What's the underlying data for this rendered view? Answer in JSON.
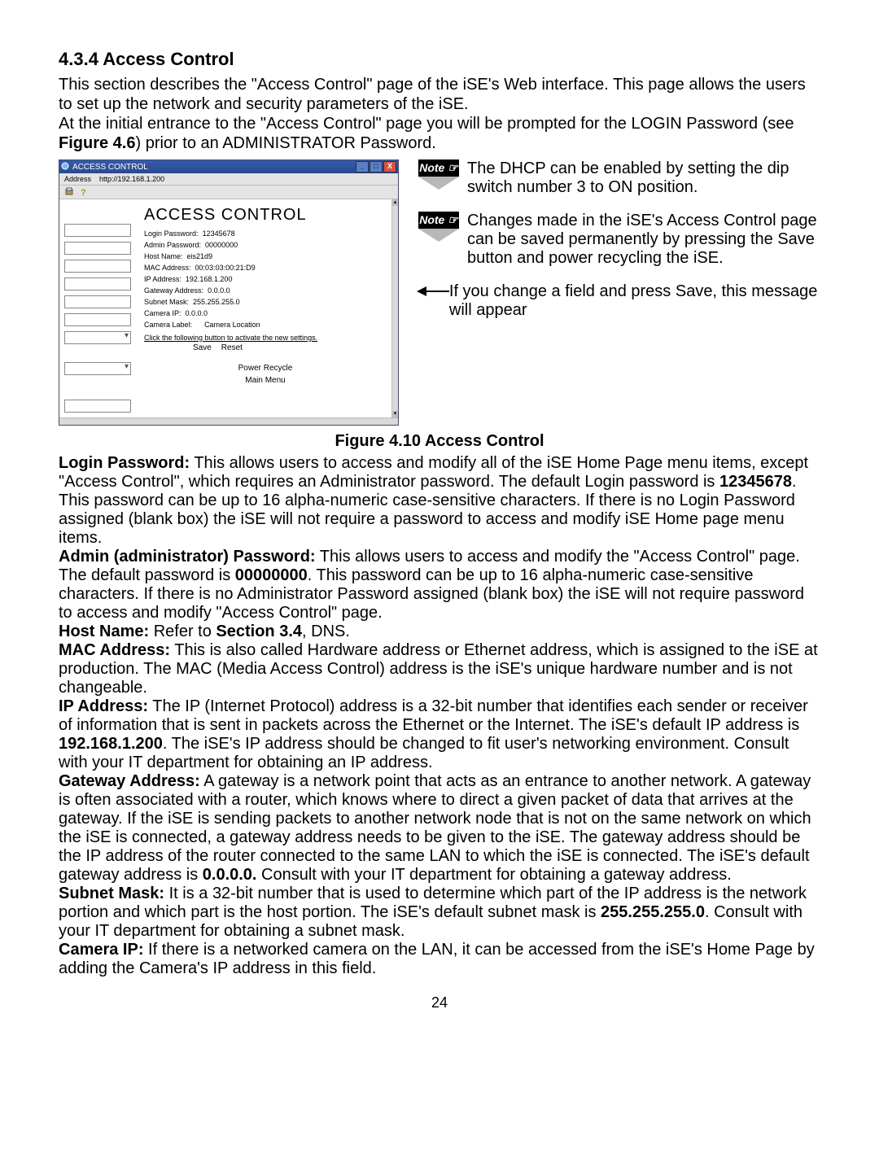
{
  "heading": "4.3.4  Access Control",
  "intro": {
    "l1": "This section describes the \"Access Control\" page of the iSE's Web interface.  This page allows the users to set up the network and security parameters of the iSE.",
    "l2a": "At the initial entrance to the \"Access Control\" page you will be prompted for the LOGIN Password (see ",
    "l2b": "Figure 4.6",
    "l2c": ") prior to an ADMINISTRATOR Password."
  },
  "browser": {
    "title": "ACCESS CONTROL",
    "address_label": "Address",
    "address_value": "http://192.168.1.200",
    "page_title": "ACCESS CONTROL",
    "rows": [
      {
        "k": "Login Password:",
        "v": "12345678"
      },
      {
        "k": "Admin Password:",
        "v": "00000000"
      },
      {
        "k": "Host Name:",
        "v": "eis21d9"
      },
      {
        "k": "MAC Address:",
        "v": "00:03:03:00:21:D9"
      },
      {
        "k": "IP Address:",
        "v": "192.168.1.200"
      },
      {
        "k": "Gateway Address:",
        "v": "0.0.0.0"
      },
      {
        "k": "Subnet Mask:",
        "v": "255.255.255.0"
      },
      {
        "k": "Camera IP:",
        "v": "0.0.0.0"
      },
      {
        "k": "Camera Label:",
        "v": "Camera Location"
      }
    ],
    "click_line": "Click the following button to activate the new settings.",
    "save": "Save",
    "reset": "Reset",
    "power": "Power Recycle",
    "main": "Main Menu"
  },
  "notes": {
    "label": "Note ☞",
    "n1": "The DHCP can be enabled by setting the dip switch number 3 to ON position.",
    "n2": "Changes made in the iSE's Access Control page can be saved permanently by pressing the Save button and power recycling the iSE.",
    "callout": "If you change a field and press Save, this message will appear"
  },
  "figure_caption": "Figure 4.10  Access Control",
  "paras": {
    "login": {
      "label": "Login Password:",
      "t1": "  This allows users to access and modify all of the iSE Home Page menu items, except \"Access Control\", which requires an Administrator password. The default Login password is ",
      "b1": "12345678",
      "t2": ". This password can be up to 16 alpha-numeric case-sensitive characters.  If there is no Login Password assigned (blank box) the iSE will not require a password to access and modify iSE Home page menu items."
    },
    "admin": {
      "label": "Admin (administrator) Password:",
      "t1": "  This allows users to access and modify the \"Access Control\" page. The default password is ",
      "b1": "00000000",
      "t2": ". This password can be up to 16 alpha-numeric case-sensitive characters.   If there is no Administrator Password assigned (blank box) the iSE will not require password to access and modify \"Access Control\" page."
    },
    "host": {
      "label": "Host Name:",
      "t1": " Refer to ",
      "b1": "Section 3.4",
      "t2": ", DNS."
    },
    "mac": {
      "label": "MAC Address:",
      "t1": " This is also called Hardware address or Ethernet address, which is assigned to the iSE at production. The MAC (Media Access Control) address is the iSE's unique hardware number and is not changeable."
    },
    "ip": {
      "label": "IP Address:",
      "t1": " The IP (Internet Protocol) address is a 32-bit number that identifies each sender or receiver of information that is sent in packets across the Ethernet or the Internet. The iSE's default IP address is ",
      "b1": "192.168.1.200",
      "t2": ". The iSE's IP address should be changed to fit user's networking environment. Consult with your IT department for obtaining an IP address."
    },
    "gw": {
      "label": "Gateway Address:",
      "t1": " A gateway is a network point that acts as an entrance to another network. A gateway is often associated with a router, which knows where to direct a given packet of data that arrives at the gateway. If the iSE is sending packets to another network node that is not on the same network on which the iSE is connected, a gateway address needs to be given to the iSE. The gateway address should be the IP address of the router connected to the same LAN to which the iSE is connected. The iSE's default gateway address is ",
      "b1": "0.0.0.0.",
      "t2": " Consult with your IT department for obtaining a gateway address."
    },
    "sm": {
      "label": "Subnet Mask:",
      "t1": " It is a 32-bit number that is used to determine which part of the IP address is the network portion and which part is the host portion. The iSE's default subnet mask is ",
      "b1": "255.255.255.0",
      "t2": ". Consult with your IT department for obtaining a subnet mask."
    },
    "cam": {
      "label": "Camera IP:",
      "t1": " If there is a networked camera on the LAN, it can be accessed from the iSE's Home Page by adding the Camera's IP address in this field."
    }
  },
  "page_number": "24"
}
